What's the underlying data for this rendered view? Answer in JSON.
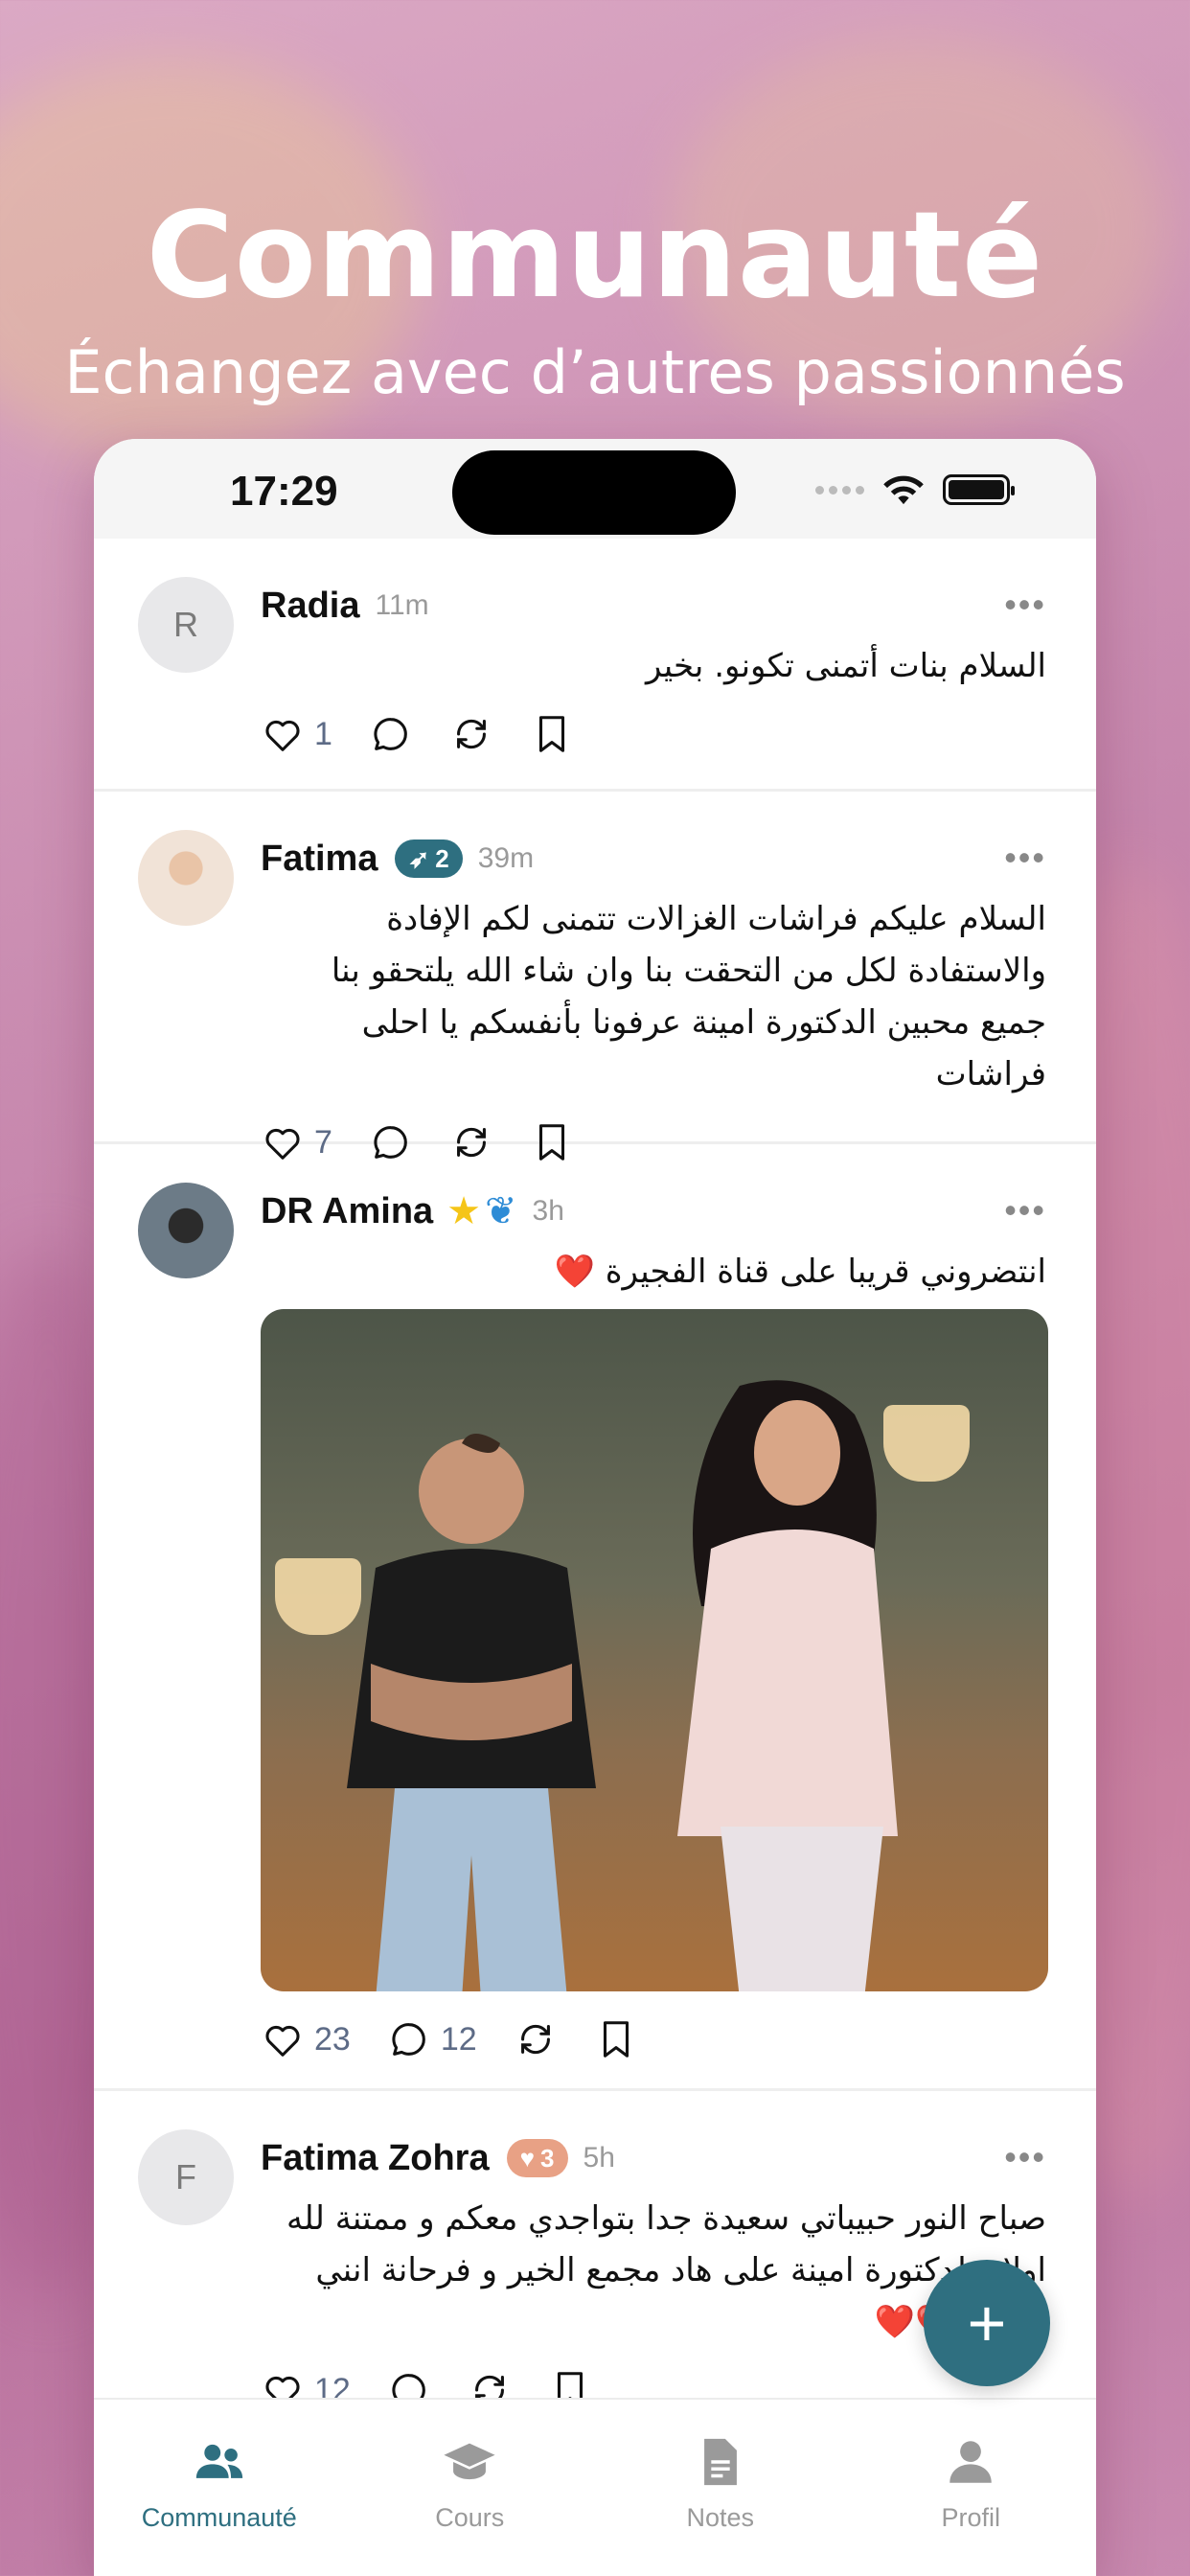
{
  "hero": {
    "title": "Communauté",
    "subtitle": "Échangez avec d’autres passionnés"
  },
  "status_bar": {
    "time": "17:29"
  },
  "posts": [
    {
      "avatar_initial": "R",
      "name": "Radia",
      "time": "11m",
      "text": "السلام  بنات أتمنى  تكونو. بخير",
      "likes": "1",
      "comments": ""
    },
    {
      "name": "Fatima",
      "badge": "2",
      "badge_icon": "rocket-icon",
      "time": "39m",
      "text": "السلام عليكم فراشات الغزالات تتمنى لكم الإفادة والاستفادة لكل من التحقت بنا وان شاء الله يلتحقو بنا جميع محبين الدكتورة امينة عرفونا بأنفسكم يا احلى فراشات",
      "likes": "7",
      "comments": ""
    },
    {
      "name": "DR Amina",
      "emoji": "⭐🦋",
      "time": "3h",
      "text": "انتضروني قريبا على قناة الفجيرة ❤️",
      "likes": "23",
      "comments": "12"
    },
    {
      "avatar_initial": "F",
      "name": "Fatima Zohra",
      "badge": "3",
      "badge_icon": "heart-icon",
      "time": "5h",
      "text": "صباح النور حبيباتي سعيدة جدا بتواجدي معكم و ممتنة لله اولا و لدكتورة امينة على هاد مجمع الخير و فرحانة انني معاكم ❤️❤️",
      "likes": "12",
      "comments": ""
    }
  ],
  "fab": {
    "label": "+"
  },
  "tabs": [
    {
      "label": "Communauté",
      "icon": "users-icon",
      "active": true
    },
    {
      "label": "Cours",
      "icon": "graduation-cap-icon"
    },
    {
      "label": "Notes",
      "icon": "document-icon"
    },
    {
      "label": "Profil",
      "icon": "user-icon"
    }
  ],
  "colors": {
    "accent": "#2e6f80",
    "like_count": "#5d6b86",
    "peach_badge": "#e8a185"
  }
}
